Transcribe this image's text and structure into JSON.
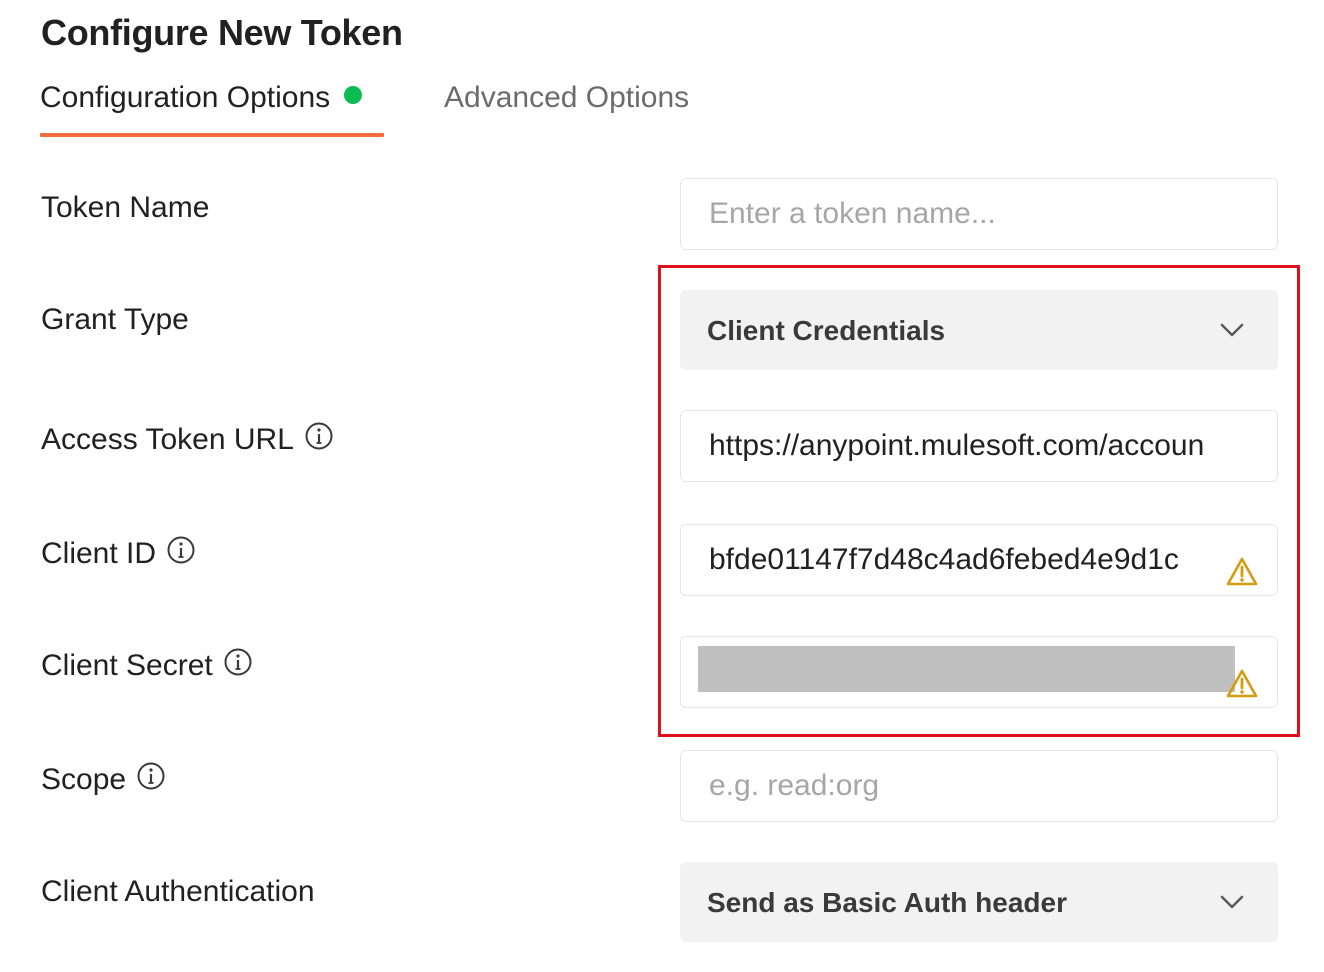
{
  "title": "Configure New Token",
  "tabs": {
    "configuration": "Configuration Options",
    "advanced": "Advanced Options"
  },
  "colors": {
    "active_tab_underline": "#f26b3a",
    "status_dot": "#0cbb52",
    "highlight_border": "#e0101a",
    "warning": "#d39b10"
  },
  "form": {
    "token_name": {
      "label": "Token Name",
      "value": "",
      "placeholder": "Enter a token name..."
    },
    "grant_type": {
      "label": "Grant Type",
      "selected": "Client Credentials",
      "icon": "chevron-down-icon"
    },
    "access_token_url": {
      "label": "Access Token URL",
      "value": "https://anypoint.mulesoft.com/accoun",
      "icon": "info-icon"
    },
    "client_id": {
      "label": "Client ID",
      "value": "bfde01147f7d48c4ad6febed4e9d1c",
      "icon": "info-icon",
      "status_icon": "warning-icon"
    },
    "client_secret": {
      "label": "Client Secret",
      "value": "",
      "icon": "info-icon",
      "status_icon": "warning-icon",
      "redacted": true
    },
    "scope": {
      "label": "Scope",
      "value": "",
      "placeholder": "e.g. read:org",
      "icon": "info-icon"
    },
    "client_authentication": {
      "label": "Client Authentication",
      "selected": "Send as Basic Auth header",
      "icon": "chevron-down-icon"
    }
  }
}
